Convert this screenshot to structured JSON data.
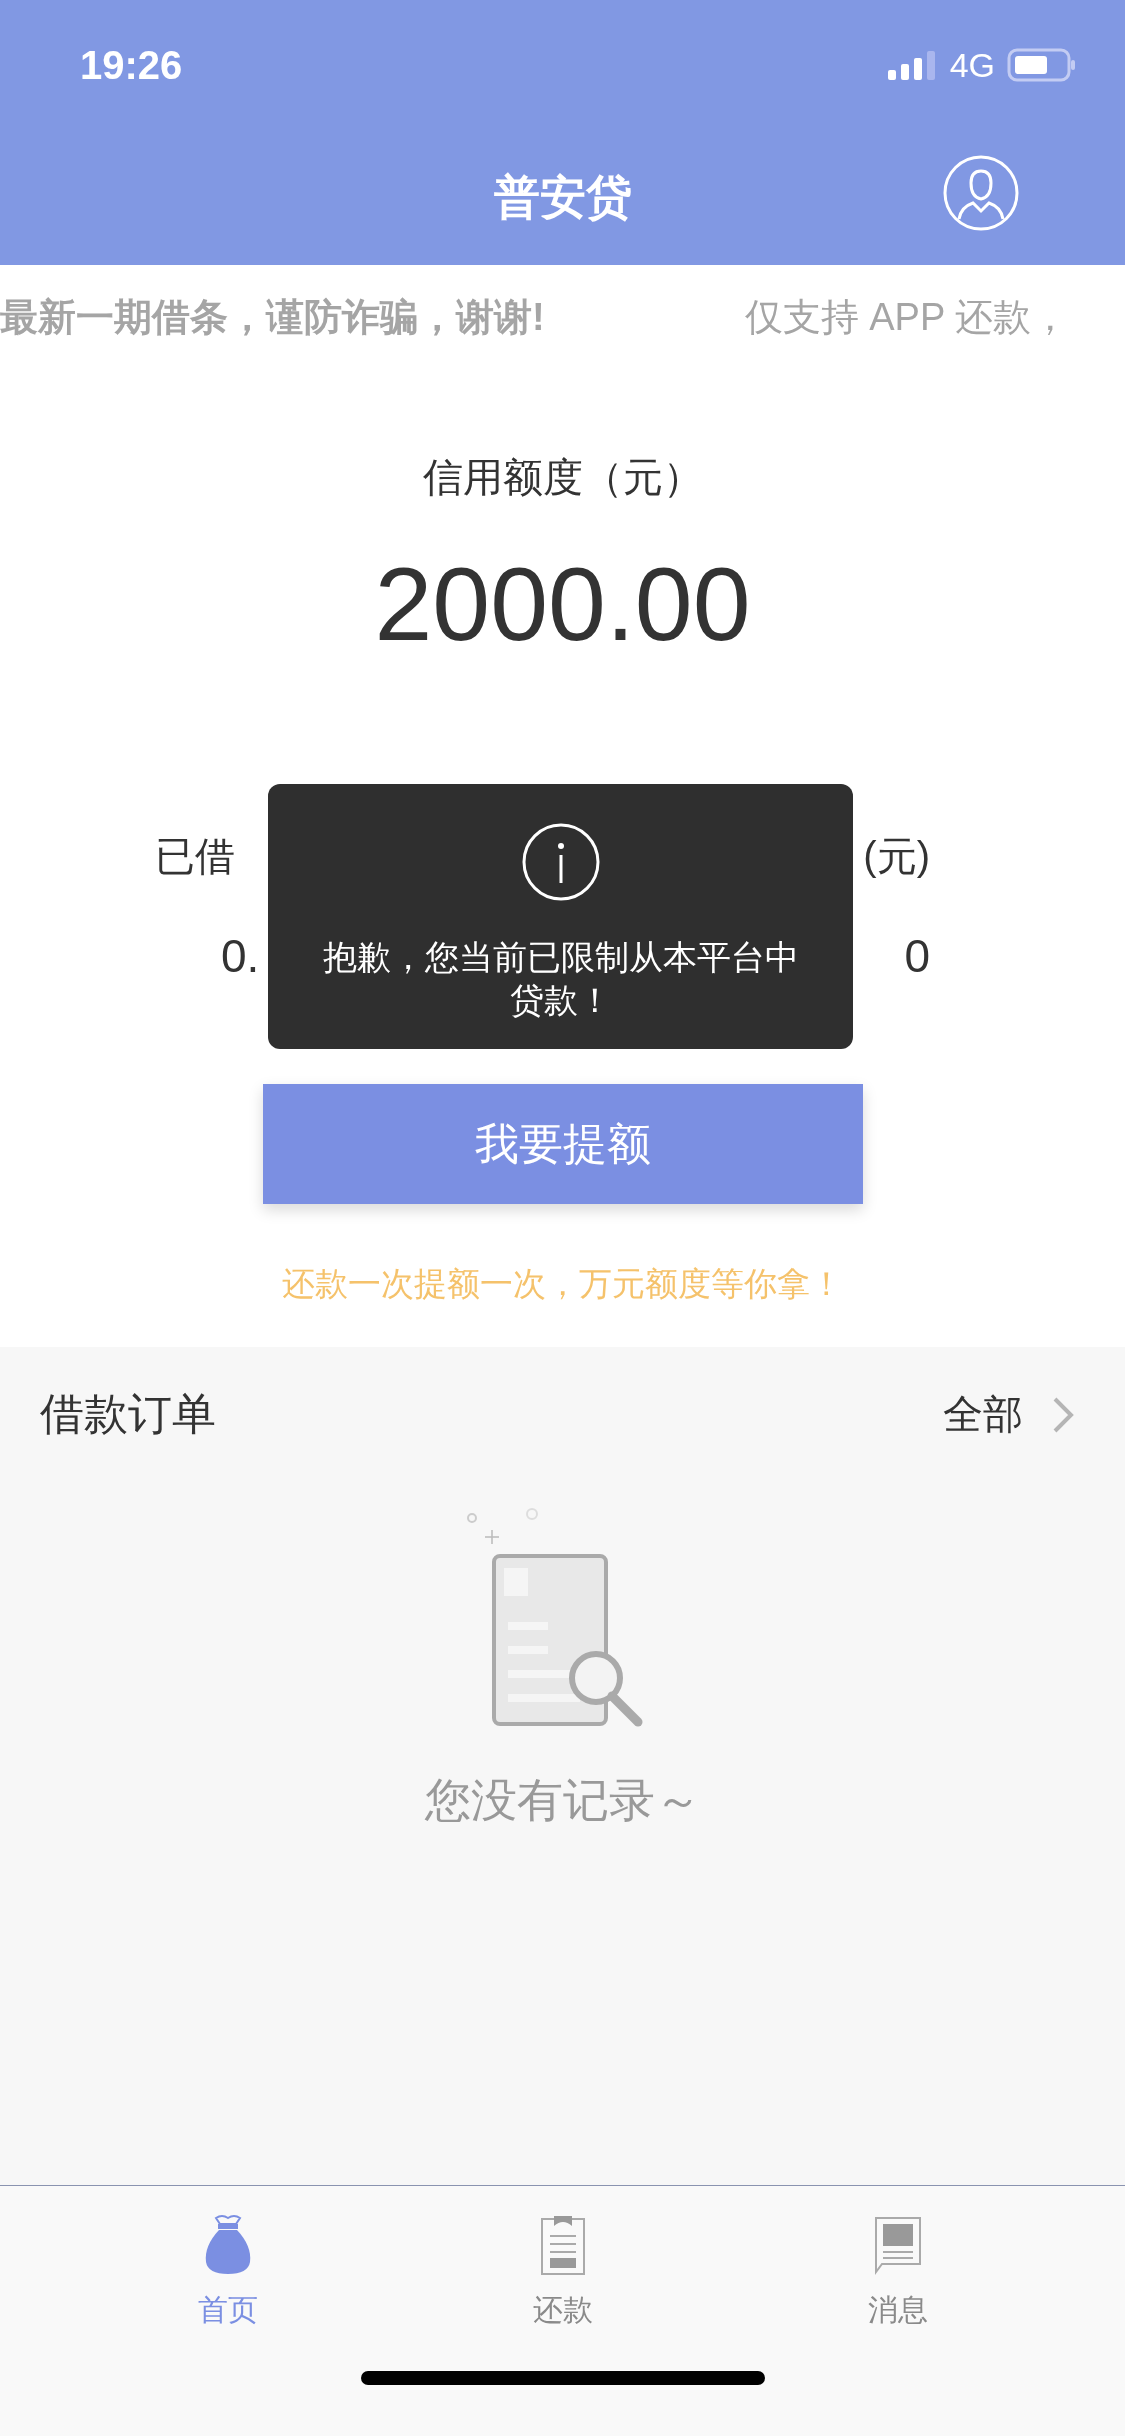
{
  "status_bar": {
    "time": "19:26",
    "network": "4G"
  },
  "nav": {
    "title": "普安贷"
  },
  "notice": [
    "最新一期借条，谨防诈骗，谢谢!",
    "仅支持 APP 还款，"
  ],
  "credit": {
    "label": "信用额度（元）",
    "amount": "2000.00"
  },
  "stats": [
    {
      "label": "已借",
      "value": "0."
    },
    {
      "label": "(元)",
      "value": "0"
    }
  ],
  "toast": {
    "message": "抱歉，您当前已限制从本平台中贷款！"
  },
  "raise_button": "我要提额",
  "promo": "还款一次提额一次，万元额度等你拿！",
  "orders": {
    "title": "借款订单",
    "all_link": "全部",
    "empty_text": "您没有记录～"
  },
  "tabs": [
    {
      "label": "首页",
      "selected": true
    },
    {
      "label": "还款",
      "selected": false
    },
    {
      "label": "消息",
      "selected": false
    }
  ]
}
